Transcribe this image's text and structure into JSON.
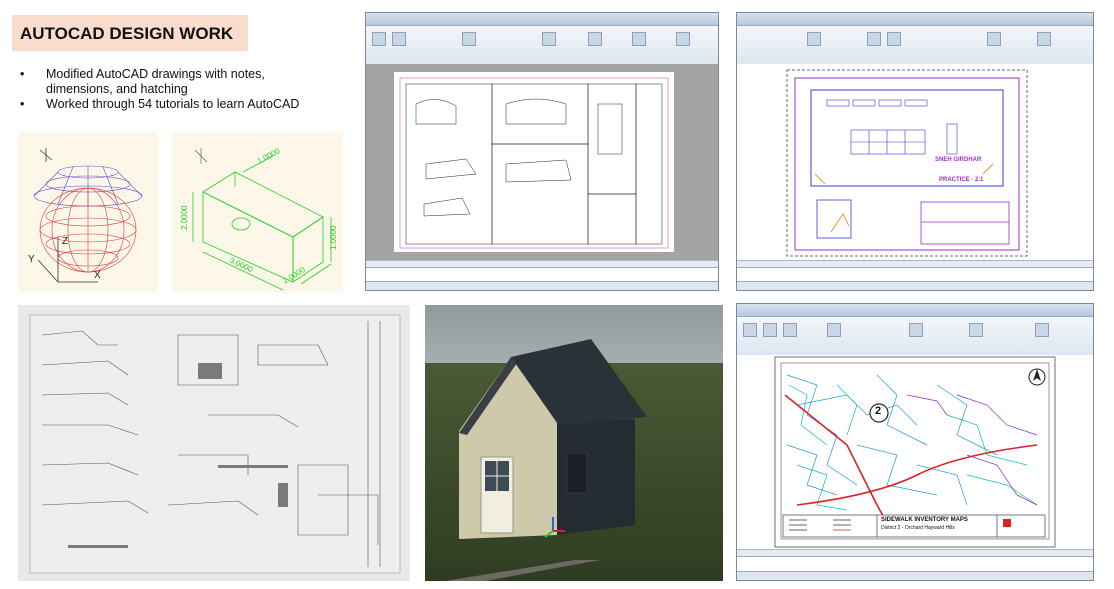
{
  "heading": "AUTOCAD DESIGN WORK",
  "bullets": [
    "Modified AutoCAD drawings with notes,",
    "dimensions, and hatching",
    "Worked through 54 tutorials to learn AutoCAD"
  ],
  "sketch_dims": [
    "1.0000",
    "2.0000",
    "1.0000",
    "3.0000",
    "2.0000"
  ],
  "sketch_axes": [
    "Z",
    "X",
    "Y"
  ],
  "practice": {
    "name": "SNEH GIRDHAR",
    "label": "PRACTICE - 2.1"
  },
  "map": {
    "number": "2",
    "title": "SIDEWALK INVENTORY MAPS",
    "subtitle": "District 2 - Orchard Hayward Hills"
  },
  "colors": {
    "title_bg": "#f9dccb",
    "sketch_bg": "#fcf7e8",
    "cad_green": "#1fd11f",
    "cad_purple": "#9c2fc9"
  },
  "icons": [
    "sketch-image",
    "cad-screenshot",
    "paper-photo",
    "house-render",
    "map-screenshot"
  ]
}
